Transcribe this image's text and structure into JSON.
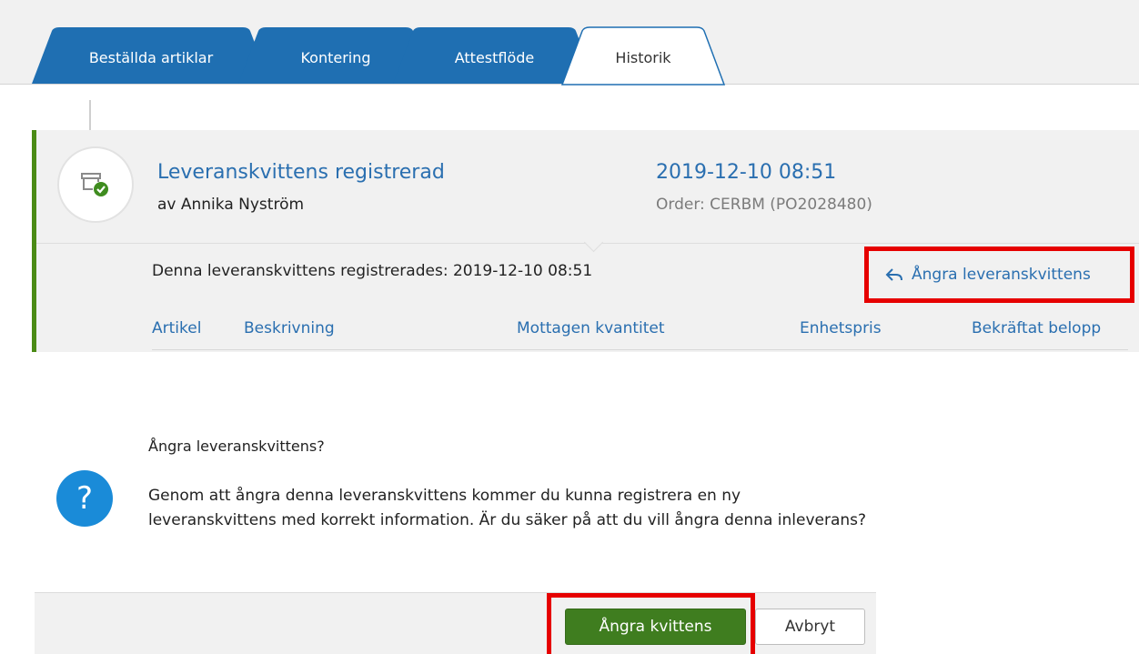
{
  "tabs": [
    {
      "label": "Beställda artiklar",
      "active": false
    },
    {
      "label": "Kontering",
      "active": false
    },
    {
      "label": "Attestflöde",
      "active": false
    },
    {
      "label": "Historik",
      "active": true
    }
  ],
  "event": {
    "icon": "delivery-check-icon",
    "title": "Leveranskvittens registrerad",
    "user": "av Annika Nyström",
    "date": "2019-12-10 08:51",
    "order": "Order: CERBM (PO2028480)",
    "registered_text": "Denna leveranskvittens registrerades: 2019-12-10 08:51",
    "undo_label": "Ångra leveranskvittens",
    "undo_icon": "reply-arrow-icon"
  },
  "table": {
    "columns": [
      "Artikel",
      "Beskrivning",
      "Mottagen kvantitet",
      "Enhetspris",
      "Bekräftat belopp"
    ]
  },
  "dialog": {
    "icon": "question-icon",
    "title": "Ångra leveranskvittens?",
    "body": "Genom att ångra denna leveranskvittens kommer du kunna registrera en ny leveranskvittens med korrekt information. Är du säker på att du vill ångra denna inleverans?",
    "confirm_label": "Ångra kvittens",
    "cancel_label": "Avbryt"
  },
  "colors": {
    "tab_blue": "#1f6fb2",
    "link_blue": "#2a6fb0",
    "accent_green": "#4b8b16",
    "highlight_red": "#e60000",
    "question_blue": "#1a8bd8"
  }
}
